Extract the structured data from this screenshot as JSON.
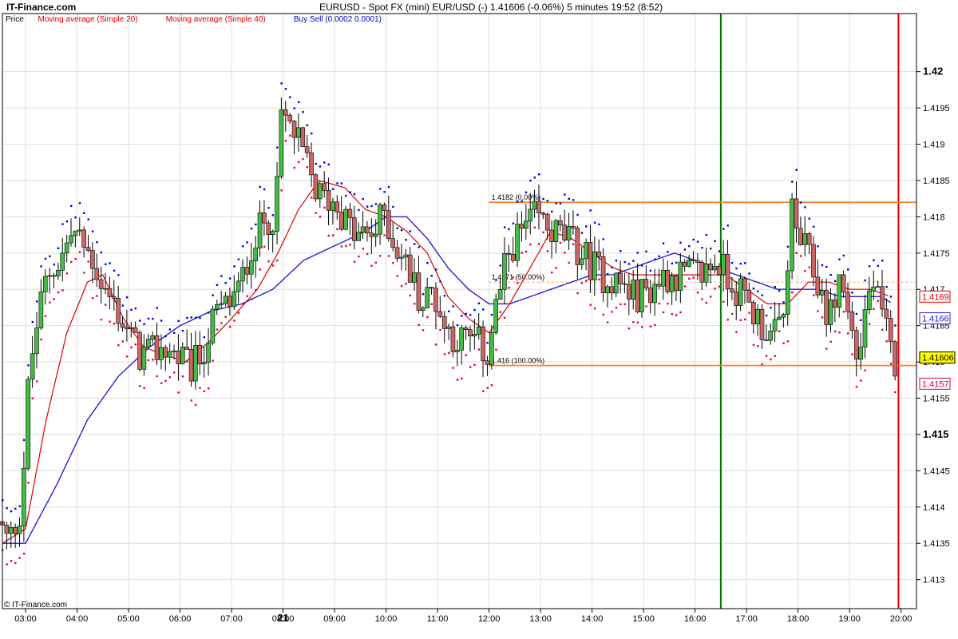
{
  "header": {
    "site": "IT-Finance.com",
    "title": "EURUSD - Spot FX (mini) EUR/USD (-)   1.41606 (-0.06%)   5 minutes  19:52 (8:52)"
  },
  "legend": [
    {
      "label": "Price",
      "color": "#000000"
    },
    {
      "label": "Moving average (Simple 20)",
      "color": "#dd0000"
    },
    {
      "label": "Moving average (Simple 40)",
      "color": "#dd0000"
    },
    {
      "label": "Buy Sell (0.0002 0.0001)",
      "color": "#0000cc"
    }
  ],
  "copyright": "© IT-Finance.com",
  "colors": {
    "up": "#44bb44",
    "down": "#cc6666",
    "ma20": "#dd0000",
    "ma40": "#2222cc",
    "buy": "#0000cc",
    "sell": "#dd0044",
    "fib": "#ff7f2a",
    "vline_green": "#007700",
    "vline_red": "#dd0000"
  },
  "chart_data": {
    "type": "candlestick",
    "symbol": "EURUSD",
    "interval": "5 minutes",
    "last_price": "1.41606",
    "change": "-0.06%",
    "ylim": [
      1.4126,
      1.4208
    ],
    "yticks": [
      "1.42",
      "1.4195",
      "1.419",
      "1.4185",
      "1.418",
      "1.4175",
      "1.417",
      "1.4165",
      "1.416",
      "1.4155",
      "1.415",
      "1.4145",
      "1.414",
      "1.4135",
      "1.413"
    ],
    "ytick_bold": [
      "1.42",
      "1.415"
    ],
    "xticks": [
      "03:00",
      "04:00",
      "05:00",
      "06:00",
      "07:00",
      "21",
      "08:00",
      "09:00",
      "10:00",
      "11:00",
      "12:00",
      "13:00",
      "14:00",
      "15:00",
      "16:00",
      "17:00",
      "18:00",
      "19:00",
      "20:00"
    ],
    "x_start_hour": 2.55,
    "x_end_hour": 20.3,
    "anchors": [
      [
        2.55,
        1.4138
      ],
      [
        2.75,
        1.4135
      ],
      [
        3.0,
        1.414
      ],
      [
        3.15,
        1.4158
      ],
      [
        3.3,
        1.4165
      ],
      [
        3.5,
        1.4172
      ],
      [
        3.75,
        1.4174
      ],
      [
        4.0,
        1.4178
      ],
      [
        4.2,
        1.4176
      ],
      [
        4.4,
        1.4174
      ],
      [
        4.6,
        1.417
      ],
      [
        4.8,
        1.4168
      ],
      [
        5.0,
        1.4165
      ],
      [
        5.3,
        1.4161
      ],
      [
        5.5,
        1.4161
      ],
      [
        5.75,
        1.4162
      ],
      [
        6.0,
        1.4161
      ],
      [
        6.3,
        1.4159
      ],
      [
        6.5,
        1.4161
      ],
      [
        6.75,
        1.4166
      ],
      [
        7.0,
        1.4168
      ],
      [
        7.25,
        1.417
      ],
      [
        7.45,
        1.4176
      ],
      [
        7.7,
        1.4179
      ],
      [
        7.95,
        1.4181
      ],
      [
        8.05,
        1.4194
      ],
      [
        8.25,
        1.4192
      ],
      [
        8.5,
        1.4188
      ],
      [
        8.75,
        1.4183
      ],
      [
        9.1,
        1.4182
      ],
      [
        9.5,
        1.4177
      ],
      [
        9.9,
        1.4178
      ],
      [
        10.05,
        1.4181
      ],
      [
        10.2,
        1.4177
      ],
      [
        10.5,
        1.4173
      ],
      [
        10.8,
        1.4168
      ],
      [
        11.0,
        1.417
      ],
      [
        11.2,
        1.4165
      ],
      [
        11.5,
        1.4163
      ],
      [
        11.8,
        1.4163
      ],
      [
        12.05,
        1.4161
      ],
      [
        12.2,
        1.4167
      ],
      [
        12.5,
        1.4176
      ],
      [
        12.75,
        1.4178
      ],
      [
        13.0,
        1.418
      ],
      [
        13.3,
        1.4178
      ],
      [
        13.6,
        1.4177
      ],
      [
        14.0,
        1.4174
      ],
      [
        14.3,
        1.4172
      ],
      [
        14.6,
        1.4171
      ],
      [
        14.9,
        1.4169
      ],
      [
        15.2,
        1.417
      ],
      [
        15.5,
        1.4172
      ],
      [
        15.8,
        1.4172
      ],
      [
        16.2,
        1.4172
      ],
      [
        16.5,
        1.4174
      ],
      [
        16.8,
        1.4171
      ],
      [
        17.0,
        1.4169
      ],
      [
        17.2,
        1.4167
      ],
      [
        17.4,
        1.4165
      ],
      [
        17.6,
        1.4163
      ],
      [
        17.8,
        1.4166
      ],
      [
        17.95,
        1.4181
      ],
      [
        18.05,
        1.4178
      ],
      [
        18.3,
        1.4174
      ],
      [
        18.5,
        1.417
      ],
      [
        18.7,
        1.4166
      ],
      [
        18.9,
        1.4172
      ],
      [
        19.1,
        1.4165
      ],
      [
        19.25,
        1.416
      ],
      [
        19.4,
        1.4168
      ],
      [
        19.55,
        1.4171
      ],
      [
        19.7,
        1.4166
      ],
      [
        19.85,
        1.4163
      ],
      [
        19.9,
        1.416
      ]
    ],
    "ma20_anchors": [
      [
        2.55,
        1.4135
      ],
      [
        3.0,
        1.4137
      ],
      [
        3.4,
        1.4152
      ],
      [
        3.8,
        1.4164
      ],
      [
        4.2,
        1.4171
      ],
      [
        4.5,
        1.4172
      ],
      [
        4.9,
        1.4166
      ],
      [
        5.3,
        1.4162
      ],
      [
        5.7,
        1.4161
      ],
      [
        6.1,
        1.416
      ],
      [
        6.6,
        1.4163
      ],
      [
        7.0,
        1.4166
      ],
      [
        7.5,
        1.417
      ],
      [
        7.9,
        1.4175
      ],
      [
        8.3,
        1.4181
      ],
      [
        8.7,
        1.4185
      ],
      [
        9.2,
        1.4184
      ],
      [
        9.6,
        1.4181
      ],
      [
        10.0,
        1.418
      ],
      [
        10.4,
        1.4178
      ],
      [
        10.8,
        1.4175
      ],
      [
        11.2,
        1.4169
      ],
      [
        11.6,
        1.4166
      ],
      [
        12.0,
        1.4164
      ],
      [
        12.4,
        1.4168
      ],
      [
        12.8,
        1.4173
      ],
      [
        13.2,
        1.4178
      ],
      [
        13.6,
        1.4177
      ],
      [
        14.0,
        1.4175
      ],
      [
        14.4,
        1.4173
      ],
      [
        14.8,
        1.4172
      ],
      [
        15.3,
        1.4172
      ],
      [
        15.8,
        1.4172
      ],
      [
        16.2,
        1.4172
      ],
      [
        16.6,
        1.4172
      ],
      [
        17.0,
        1.417
      ],
      [
        17.4,
        1.4168
      ],
      [
        17.8,
        1.4168
      ],
      [
        18.2,
        1.4171
      ],
      [
        18.6,
        1.4171
      ],
      [
        19.0,
        1.417
      ],
      [
        19.4,
        1.417
      ],
      [
        19.8,
        1.4169
      ]
    ],
    "ma40_anchors": [
      [
        2.55,
        1.4135
      ],
      [
        3.0,
        1.4135
      ],
      [
        3.6,
        1.4143
      ],
      [
        4.2,
        1.4152
      ],
      [
        4.8,
        1.4158
      ],
      [
        5.4,
        1.4162
      ],
      [
        6.0,
        1.4165
      ],
      [
        6.6,
        1.4167
      ],
      [
        7.2,
        1.4168
      ],
      [
        7.8,
        1.417
      ],
      [
        8.4,
        1.4174
      ],
      [
        9.0,
        1.4176
      ],
      [
        9.6,
        1.4178
      ],
      [
        10.0,
        1.418
      ],
      [
        10.4,
        1.418
      ],
      [
        10.8,
        1.4177
      ],
      [
        11.2,
        1.4173
      ],
      [
        11.6,
        1.417
      ],
      [
        12.0,
        1.4168
      ],
      [
        12.4,
        1.4168
      ],
      [
        12.8,
        1.4169
      ],
      [
        13.2,
        1.417
      ],
      [
        13.6,
        1.4171
      ],
      [
        14.0,
        1.4172
      ],
      [
        14.4,
        1.4172
      ],
      [
        14.8,
        1.4173
      ],
      [
        15.2,
        1.4174
      ],
      [
        15.6,
        1.4175
      ],
      [
        16.0,
        1.4174
      ],
      [
        16.4,
        1.4173
      ],
      [
        16.8,
        1.4172
      ],
      [
        17.2,
        1.4171
      ],
      [
        17.6,
        1.417
      ],
      [
        18.0,
        1.417
      ],
      [
        18.4,
        1.417
      ],
      [
        18.8,
        1.4169
      ],
      [
        19.2,
        1.4169
      ],
      [
        19.6,
        1.4169
      ],
      [
        19.85,
        1.4168
      ]
    ],
    "fibonacci": [
      {
        "price": 1.4182,
        "label": "1.4182 (0.00%)",
        "x_from": 12.0,
        "x_to": 20.3
      },
      {
        "price": 1.4171,
        "label": "1.4171 (50.00%)",
        "x_from": 12.0,
        "x_to": 20.3
      },
      {
        "price": 1.41595,
        "label": "1.416 (100.00%)",
        "x_from": 12.0,
        "x_to": 20.3
      }
    ],
    "vertical_lines": [
      {
        "hour": 16.5,
        "color": "green"
      },
      {
        "hour": 19.95,
        "color": "red"
      }
    ],
    "price_badges": [
      {
        "price": 1.4169,
        "label": "1.4169",
        "color": "#dd0000"
      },
      {
        "price": 1.4166,
        "label": "1.4166",
        "color": "#2222cc"
      },
      {
        "price": 1.41606,
        "label": "1.41606",
        "color": "#000000",
        "bg": "#ffff00"
      },
      {
        "price": 1.4157,
        "label": "1.4157",
        "color": "#dd0044"
      }
    ]
  }
}
